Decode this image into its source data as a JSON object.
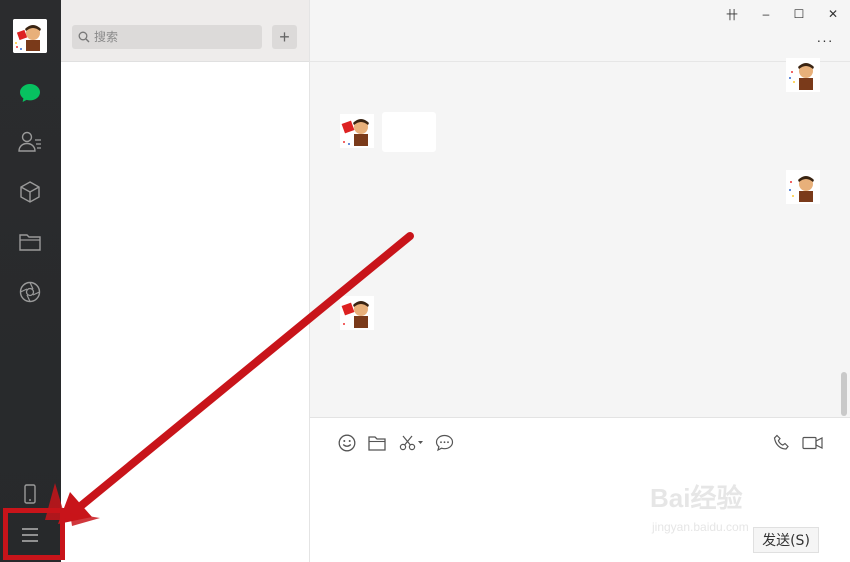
{
  "window": {
    "pin_glyph": "卄",
    "minimize_glyph": "–",
    "maximize_glyph": "☐",
    "close_glyph": "✕"
  },
  "sidebar": {
    "icons": [
      "chat-icon",
      "contacts-icon",
      "favorites-icon",
      "files-icon",
      "moments-icon",
      "phone-icon",
      "menu-icon"
    ],
    "active_color": "#07c160"
  },
  "search": {
    "placeholder": "搜索"
  },
  "list": {
    "add_label": "+"
  },
  "chat": {
    "more_label": "···",
    "toolbar_icons": [
      "emoji-icon",
      "folder-icon",
      "scissors-icon",
      "chat-history-icon",
      "voice-call-icon",
      "video-call-icon"
    ],
    "send_label": "发送(S)"
  },
  "watermark": {
    "text": "Bai经验",
    "sub": "jingyan.baidu.com"
  },
  "annotation": {
    "color": "#c8141a"
  }
}
